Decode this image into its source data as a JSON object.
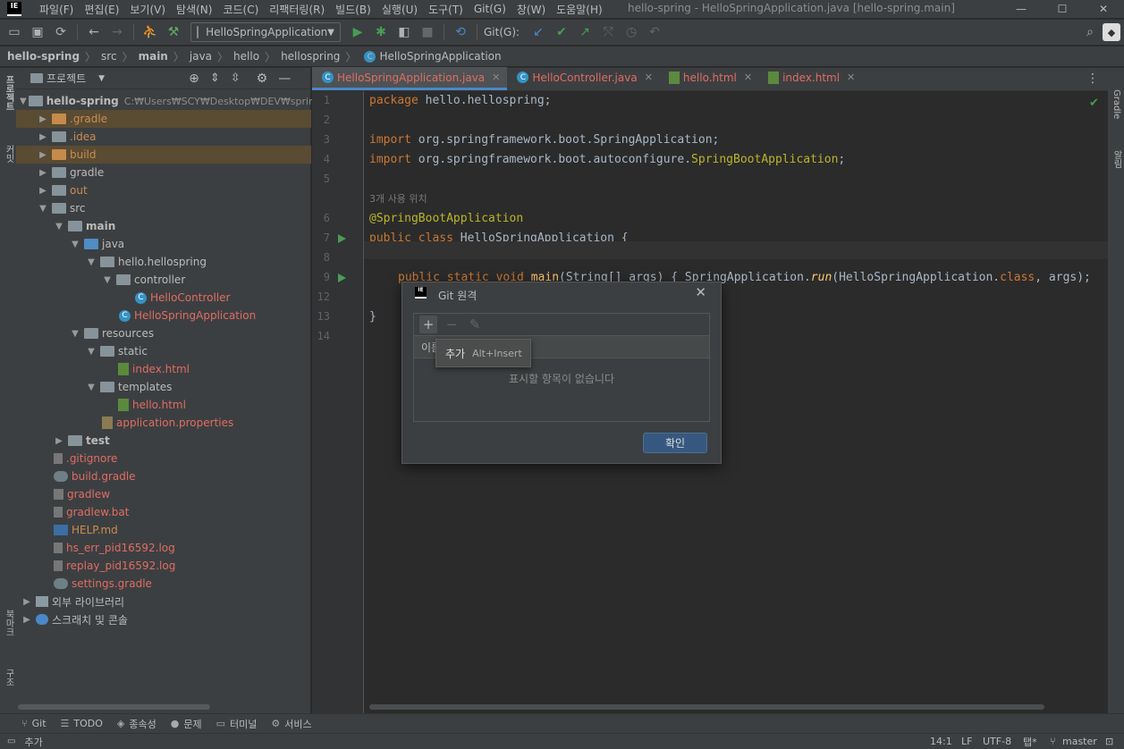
{
  "menu": {
    "items": [
      "파일(F)",
      "편집(E)",
      "보기(V)",
      "탐색(N)",
      "코드(C)",
      "리팩터링(R)",
      "빌드(B)",
      "실행(U)",
      "도구(T)",
      "Git(G)",
      "창(W)",
      "도움말(H)"
    ],
    "window_title": "hello-spring - HelloSpringApplication.java [hello-spring.main]",
    "logo": "IE"
  },
  "toolbar": {
    "run_config": "HelloSpringApplication",
    "git_label": "Git(G):"
  },
  "breadcrumb": [
    "hello-spring",
    "src",
    "main",
    "java",
    "hello",
    "hellospring",
    "HelloSpringApplication"
  ],
  "left_strip": {
    "project": "프로젝트",
    "commit": "커밋",
    "bookmarks": "북마크",
    "structure": "구조"
  },
  "right_strip": {
    "gradle": "Gradle",
    "notifications": "알림"
  },
  "project_panel": {
    "title": "프로젝트",
    "root_name": "hello-spring",
    "root_path": "C:₩Users₩SCY₩Desktop₩DEV₩spring_",
    "items": [
      {
        "label": ".gradle"
      },
      {
        "label": ".idea"
      },
      {
        "label": "build"
      },
      {
        "label": "gradle"
      },
      {
        "label": "out"
      },
      {
        "label": "src"
      },
      {
        "label": "main"
      },
      {
        "label": "java"
      },
      {
        "label": "hello.hellospring"
      },
      {
        "label": "controller"
      },
      {
        "label": "HelloController"
      },
      {
        "label": "HelloSpringApplication"
      },
      {
        "label": "resources"
      },
      {
        "label": "static"
      },
      {
        "label": "index.html"
      },
      {
        "label": "templates"
      },
      {
        "label": "hello.html"
      },
      {
        "label": "application.properties"
      },
      {
        "label": "test"
      },
      {
        "label": ".gitignore"
      },
      {
        "label": "build.gradle"
      },
      {
        "label": "gradlew"
      },
      {
        "label": "gradlew.bat"
      },
      {
        "label": "HELP.md"
      },
      {
        "label": "hs_err_pid16592.log"
      },
      {
        "label": "replay_pid16592.log"
      },
      {
        "label": "settings.gradle"
      },
      {
        "label": "외부 라이브러리"
      },
      {
        "label": "스크래치 및 콘솔"
      }
    ]
  },
  "tabs": [
    {
      "label": "HelloSpringApplication.java"
    },
    {
      "label": "HelloController.java"
    },
    {
      "label": "hello.html"
    },
    {
      "label": "index.html"
    }
  ],
  "editor": {
    "line_numbers": [
      "1",
      "2",
      "3",
      "4",
      "5",
      "6",
      "7",
      "8",
      "9",
      "12",
      "13",
      "14"
    ],
    "usage_hint": "3개 사용 위치",
    "code": {
      "l1_kw": "package",
      "l1_rest": " hello.hellospring;",
      "l3_kw": "import",
      "l3_rest": " org.springframework.boot.SpringApplication;",
      "l4_kw": "import",
      "l4_rest": " org.springframework.boot.autoconfigure.",
      "l4_cls": "SpringBootApplication",
      "l4_end": ";",
      "l6": "@SpringBootApplication",
      "l7_kw": "public class",
      "l7_rest": " HelloSpringApplication {",
      "l9_kw": "public static void",
      "l9_fn": " main",
      "l9_a": "(String[] args) { SpringApplication.",
      "l9_run": "run",
      "l9_b": "(HelloSpringApplication.",
      "l9_cls": "class",
      "l9_c": ", args);",
      "l13": "}"
    }
  },
  "dialog": {
    "title": "Git 원격",
    "column_header": "이름",
    "empty_text": "표시할 항목이 없습니다",
    "ok_label": "확인",
    "tooltip_label": "추가",
    "tooltip_shortcut": "Alt+Insert"
  },
  "bottom_tools": [
    "Git",
    "TODO",
    "종속성",
    "문제",
    "터미널",
    "서비스"
  ],
  "status": {
    "action": "추가",
    "position": "14:1",
    "line_sep": "LF",
    "encoding": "UTF-8",
    "indent": "탭*",
    "branch": "master"
  }
}
